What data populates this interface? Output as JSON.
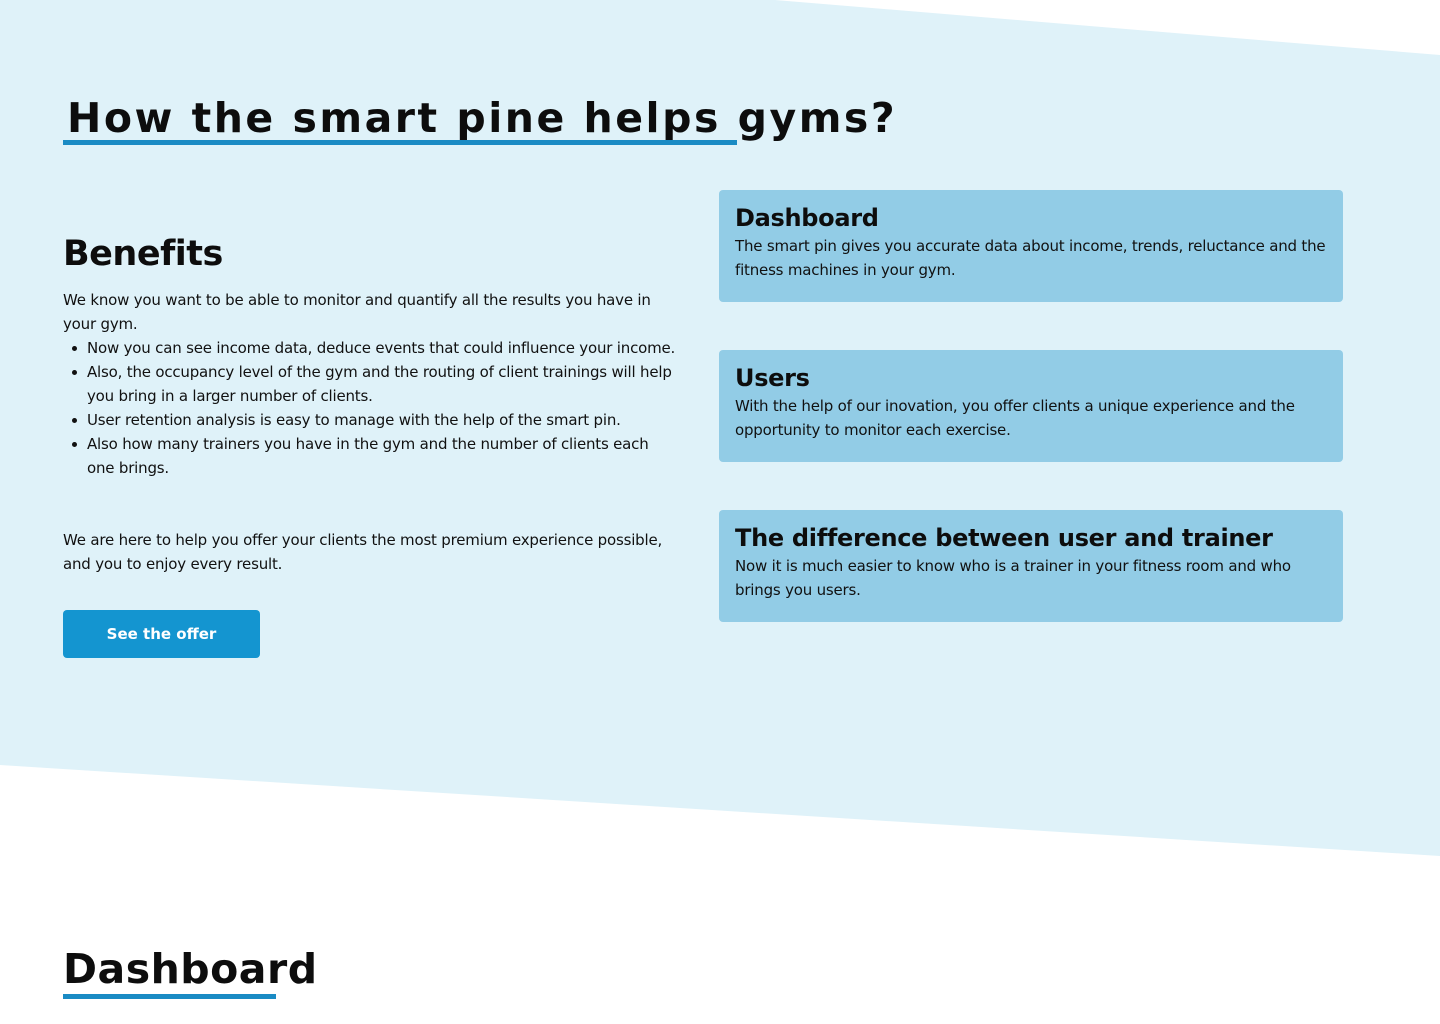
{
  "colors": {
    "section_background": "#dff2f9",
    "accent": "#1a8bc4",
    "button": "#1495d0",
    "card_background": "#92cce6"
  },
  "section": {
    "title": "How the smart pine helps gyms?"
  },
  "benefits": {
    "heading": "Benefits",
    "intro": "We know you want to be able to monitor and quantify all the results you have in your gym.",
    "items": [
      "Now you can see income data, deduce events that could influence your income.",
      "Also, the occupancy level of the gym and the routing of client trainings will help you bring in a larger number of clients.",
      "User retention analysis is easy to manage with the help of the smart pin.",
      "Also how many trainers you have in the gym and the number of clients each one brings."
    ],
    "closing": "We are here to help you offer your clients the most premium experience possible, and you to enjoy every result."
  },
  "cta": {
    "label": "See the offer"
  },
  "cards": [
    {
      "title": "Dashboard",
      "text": "The smart pin gives you accurate data about income, trends, reluctance and the fitness machines in your gym."
    },
    {
      "title": "Users",
      "text": "With the help of our inovation, you offer clients a unique experience and the opportunity to monitor each exercise."
    },
    {
      "title": "The difference between user and trainer",
      "text": "Now it is much easier to know who is a trainer in your fitness room and who brings you users."
    }
  ],
  "next_section": {
    "title": "Dashboard"
  }
}
